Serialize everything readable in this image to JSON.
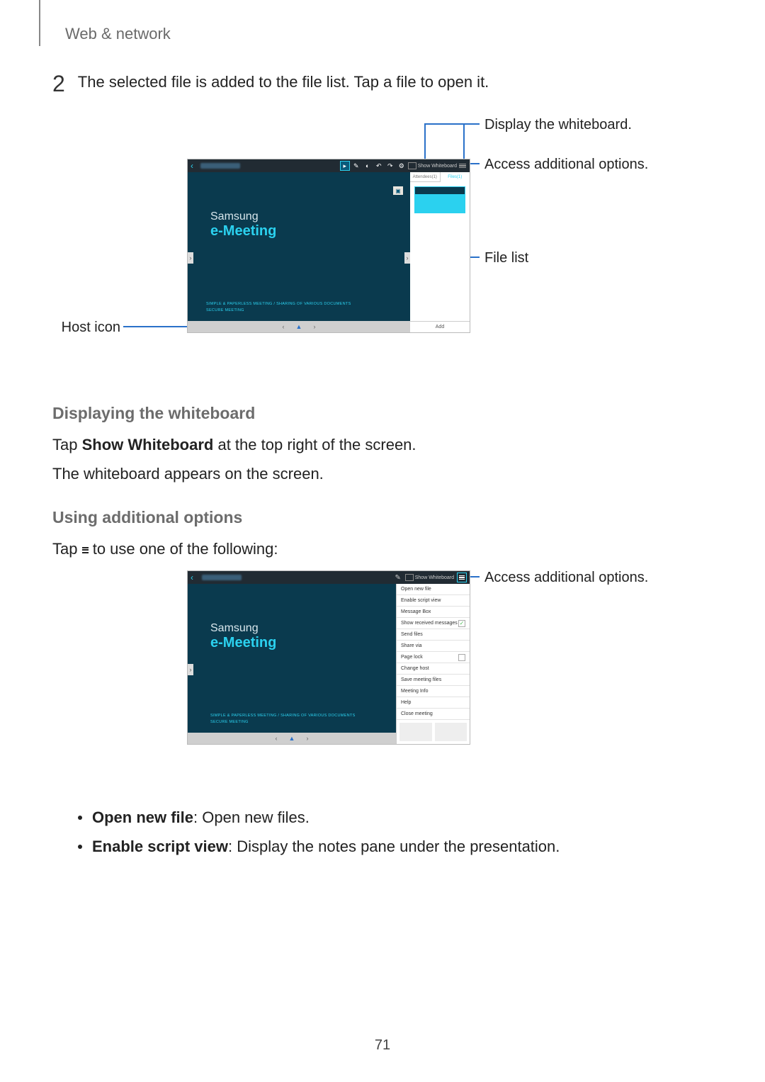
{
  "pageHeader": "Web & network",
  "pageNumber": "71",
  "step": {
    "num": "2",
    "text": "The selected file is added to the file list. Tap a file to open it."
  },
  "shot1": {
    "topbar": {
      "showWhiteboard": "Show Whiteboard"
    },
    "main": {
      "brand": "Samsung",
      "product": "e-Meeting",
      "sub1": "SIMPLE & PAPERLESS MEETING / SHARING OF VARIOUS DOCUMENTS",
      "sub2": "SECURE MEETING"
    },
    "side": {
      "tabAttendees": "Attendees(1)",
      "tabFiles": "Files(1)",
      "add": "Add"
    },
    "callouts": {
      "host": "Host icon",
      "display": "Display the whiteboard.",
      "options": "Access additional options.",
      "filelist": "File list"
    }
  },
  "section1": {
    "heading": "Displaying the whiteboard",
    "p1_a": "Tap ",
    "p1_b": "Show Whiteboard",
    "p1_c": " at the top right of the screen.",
    "p2": "The whiteboard appears on the screen."
  },
  "section2": {
    "heading": "Using additional options",
    "p_a": "Tap ",
    "p_b": " to use one of the following:"
  },
  "shot2": {
    "topbar": {
      "showWhiteboard": "Show Whiteboard"
    },
    "main": {
      "brand": "Samsung",
      "product": "e-Meeting",
      "sub1": "SIMPLE & PAPERLESS MEETING / SHARING OF VARIOUS DOCUMENTS",
      "sub2": "SECURE MEETING"
    },
    "menu": [
      "Open new file",
      "Enable script view",
      "Message Box",
      "Show received messages",
      "Send files",
      "Share via",
      "Page lock",
      "Change host",
      "Save meeting files",
      "Meeting Info",
      "Help",
      "Close meeting"
    ],
    "callouts": {
      "options": "Access additional options."
    }
  },
  "bullets": [
    {
      "b": "Open new file",
      "r": ": Open new files."
    },
    {
      "b": "Enable script view",
      "r": ": Display the notes pane under the presentation."
    }
  ]
}
